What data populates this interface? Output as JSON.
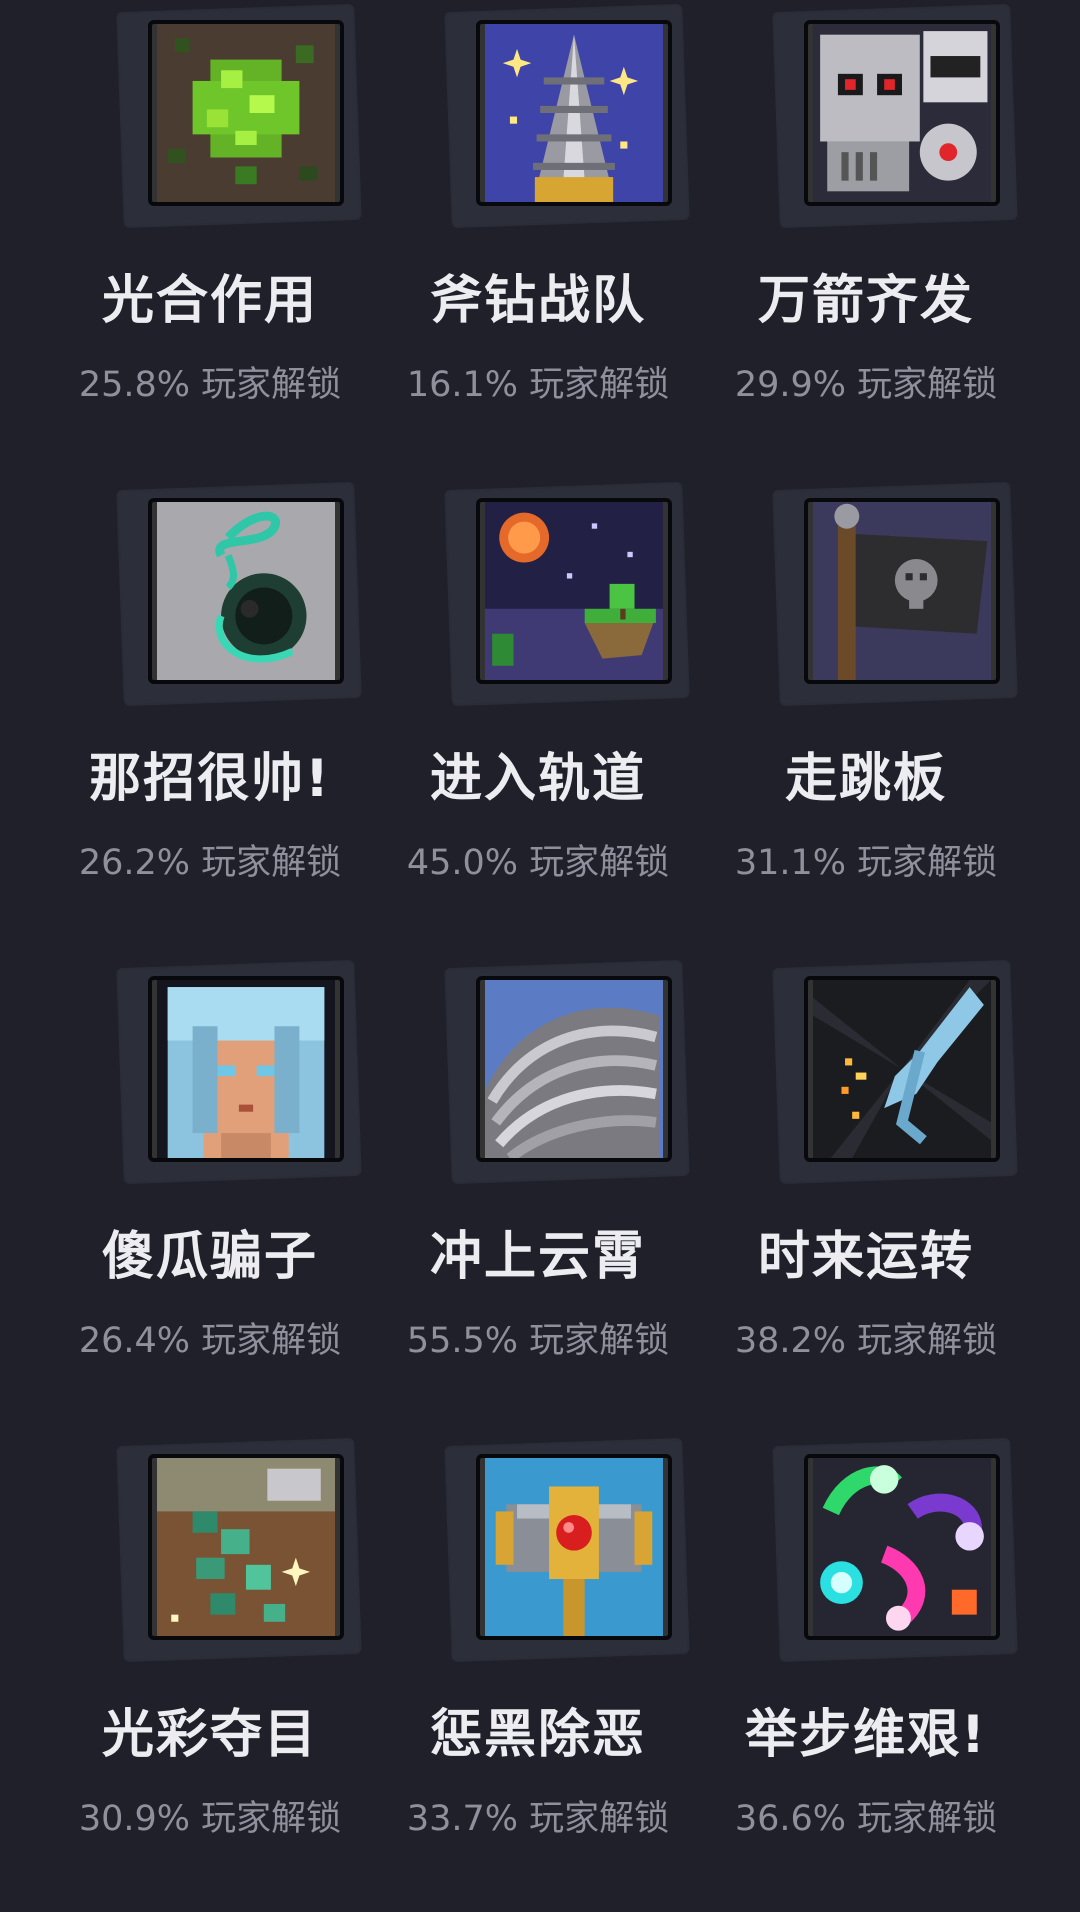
{
  "achievements": [
    {
      "title": "光合作用",
      "percent": "25.8%",
      "unlock_text": "玩家解锁",
      "icon": "leaf-moss-icon"
    },
    {
      "title": "斧钻战队",
      "percent": "16.1%",
      "unlock_text": "玩家解锁",
      "icon": "drill-icon"
    },
    {
      "title": "万箭齐发",
      "percent": "29.9%",
      "unlock_text": "玩家解锁",
      "icon": "skull-mech-icon"
    },
    {
      "title": "那招很帅!",
      "percent": "26.2%",
      "unlock_text": "玩家解锁",
      "icon": "grappling-hook-icon"
    },
    {
      "title": "进入轨道",
      "percent": "45.0%",
      "unlock_text": "玩家解锁",
      "icon": "sky-island-icon"
    },
    {
      "title": "走跳板",
      "percent": "31.1%",
      "unlock_text": "玩家解锁",
      "icon": "pirate-flag-icon"
    },
    {
      "title": "傻瓜骗子",
      "percent": "26.4%",
      "unlock_text": "玩家解锁",
      "icon": "blue-hair-girl-icon"
    },
    {
      "title": "冲上云霄",
      "percent": "55.5%",
      "unlock_text": "玩家解锁",
      "icon": "wings-icon"
    },
    {
      "title": "时来运转",
      "percent": "38.2%",
      "unlock_text": "玩家解锁",
      "icon": "ghost-hand-icon"
    },
    {
      "title": "光彩夺目",
      "percent": "30.9%",
      "unlock_text": "玩家解锁",
      "icon": "gem-ore-icon"
    },
    {
      "title": "惩黑除恶",
      "percent": "33.7%",
      "unlock_text": "玩家解锁",
      "icon": "hammer-icon"
    },
    {
      "title": "举步维艰!",
      "percent": "36.6%",
      "unlock_text": "玩家解锁",
      "icon": "rainbow-orbs-icon"
    }
  ]
}
